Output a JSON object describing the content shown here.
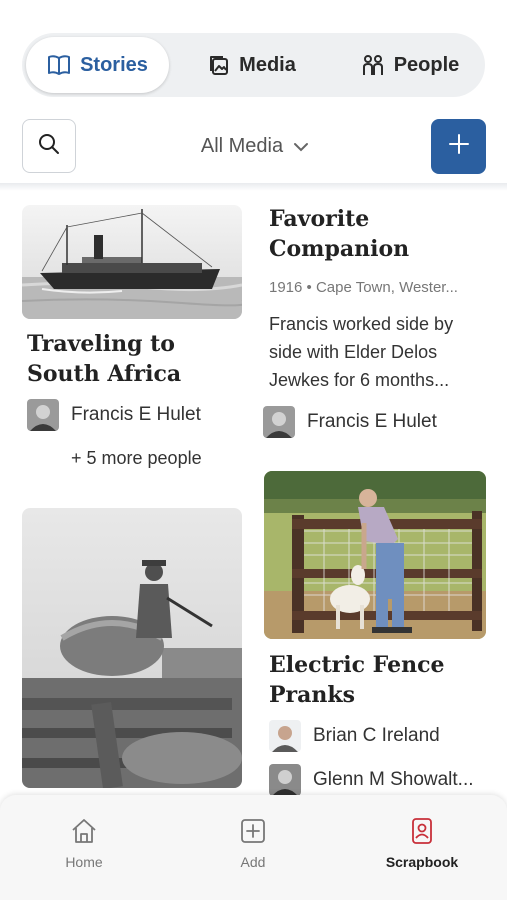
{
  "tabs": [
    {
      "label": "Stories",
      "icon": "book-icon",
      "active": true
    },
    {
      "label": "Media",
      "icon": "media-icon",
      "active": false
    },
    {
      "label": "People",
      "icon": "people-icon",
      "active": false
    }
  ],
  "toolbar": {
    "filter_label": "All Media",
    "add_label": "+",
    "accent_color": "#2b5fa0"
  },
  "cards": [
    {
      "title": "Traveling to South Africa",
      "person": "Francis E Hulet",
      "more": "+ 5 more people"
    },
    {
      "title": "Favorite Companion",
      "meta": "1916 • Cape Town, Wester...",
      "description": "Francis worked side by side with Elder Delos Jewkes for 6 months...",
      "person": "Francis E Hulet"
    },
    {
      "title": "Electric Fence Pranks",
      "people": [
        "Brian C Ireland",
        "Glenn M Showalt..."
      ]
    }
  ],
  "bottom_nav": [
    {
      "label": "Home",
      "icon": "home-icon",
      "active": false
    },
    {
      "label": "Add",
      "icon": "add-square-icon",
      "active": false
    },
    {
      "label": "Scrapbook",
      "icon": "scrapbook-icon",
      "active": true,
      "color": "#c8303a"
    }
  ]
}
